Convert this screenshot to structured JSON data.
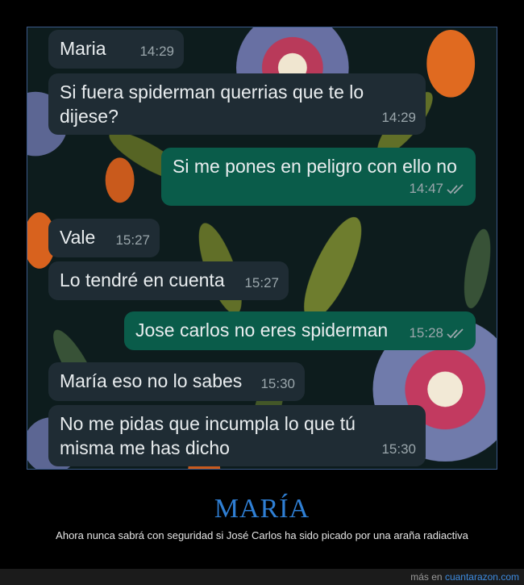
{
  "messages": [
    {
      "text": "Maria",
      "time": "14:29",
      "dir": "in"
    },
    {
      "text": "Si fuera spiderman querrias que te lo dijese?",
      "time": "14:29",
      "dir": "in"
    },
    {
      "text": "Si me pones en peligro con ello no",
      "time": "14:47",
      "dir": "out",
      "status": "read"
    },
    {
      "text": "Vale",
      "time": "15:27",
      "dir": "in"
    },
    {
      "text": "Lo tendré en cuenta",
      "time": "15:27",
      "dir": "in"
    },
    {
      "text": "Jose carlos no eres spiderman",
      "time": "15:28",
      "dir": "out",
      "status": "read"
    },
    {
      "text": "María eso no lo sabes",
      "time": "15:30",
      "dir": "in"
    },
    {
      "text": "No me pidas que incumpla lo que tú misma me has dicho",
      "time": "15:30",
      "dir": "in"
    }
  ],
  "post": {
    "title": "MARÍA",
    "caption": "Ahora nunca sabrá con seguridad si José Carlos ha sido picado por una araña radiactiva",
    "footer_prefix": "más en",
    "footer_site": "cuantarazon.com"
  },
  "colors": {
    "incoming": "#1f2c34",
    "outgoing": "#0a5c4a",
    "title": "#2f7fd4",
    "link": "#3d8be0"
  }
}
